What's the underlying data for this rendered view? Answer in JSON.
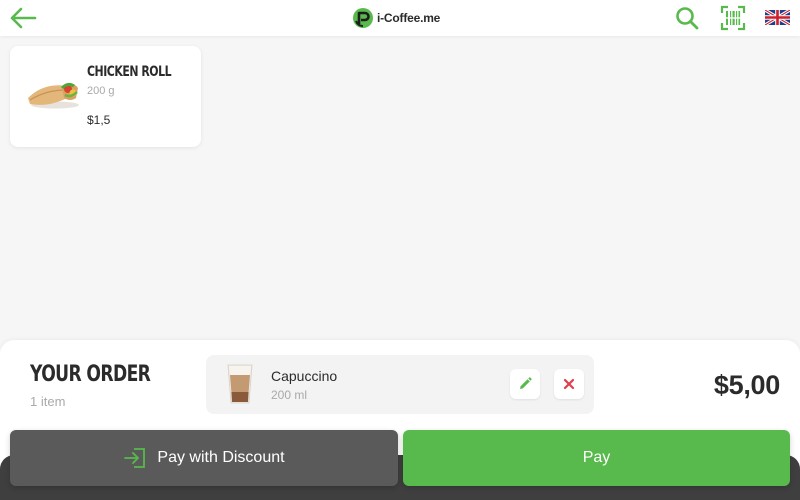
{
  "header": {
    "logo_text": "i-Coffee.me",
    "back_icon": "arrow-left-icon",
    "search_icon": "search-icon",
    "scanner_icon": "barcode-scanner-icon",
    "language_icon": "uk-flag-icon",
    "accent_color": "#58ba4c"
  },
  "products": [
    {
      "name": "CHICKEN ROLL",
      "weight": "200 g",
      "price": "$1,5",
      "image_icon": "chicken-roll-image"
    }
  ],
  "order": {
    "title": "YOUR ORDER",
    "count": "1 item",
    "items": [
      {
        "name": "Capuccino",
        "volume": "200 ml",
        "image_icon": "cappuccino-cup-image",
        "edit_icon": "pencil-icon",
        "remove_icon": "close-icon"
      }
    ],
    "total": "$5,00"
  },
  "actions": {
    "discount_label": "Pay with Discount",
    "discount_icon": "sign-in-icon",
    "pay_label": "Pay",
    "pay_color": "#58ba4c",
    "discount_color": "#5a5a5a"
  }
}
